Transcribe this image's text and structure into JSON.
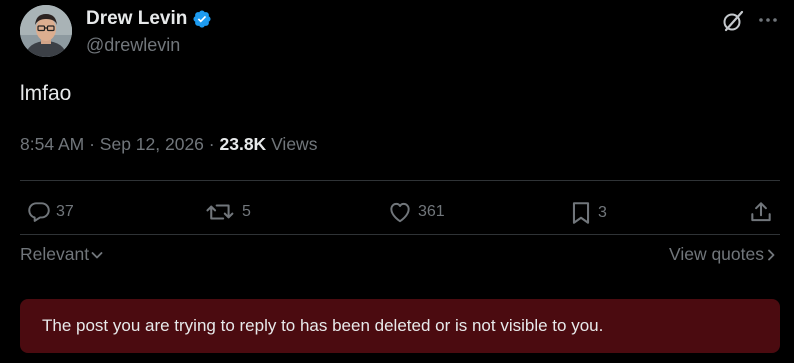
{
  "author": {
    "name": "Drew Levin",
    "handle": "@drewlevin",
    "verified": true,
    "verified_color": "#1d9bf0"
  },
  "header_icons": [
    "grok-icon",
    "more-options-icon"
  ],
  "post": {
    "text": "lmfao",
    "time": "8:54 AM",
    "date": "Sep 12, 2026",
    "separator": "·",
    "views_count": "23.8K",
    "views_label": "Views"
  },
  "actions": {
    "replies": "37",
    "reposts": "5",
    "likes": "361",
    "bookmarks": "3"
  },
  "filters": {
    "sort_label": "Relevant",
    "view_quotes_label": "View quotes"
  },
  "notice": {
    "text": "The post you are trying to reply to has been deleted or is not visible to you.",
    "background": "#4b0b10"
  }
}
